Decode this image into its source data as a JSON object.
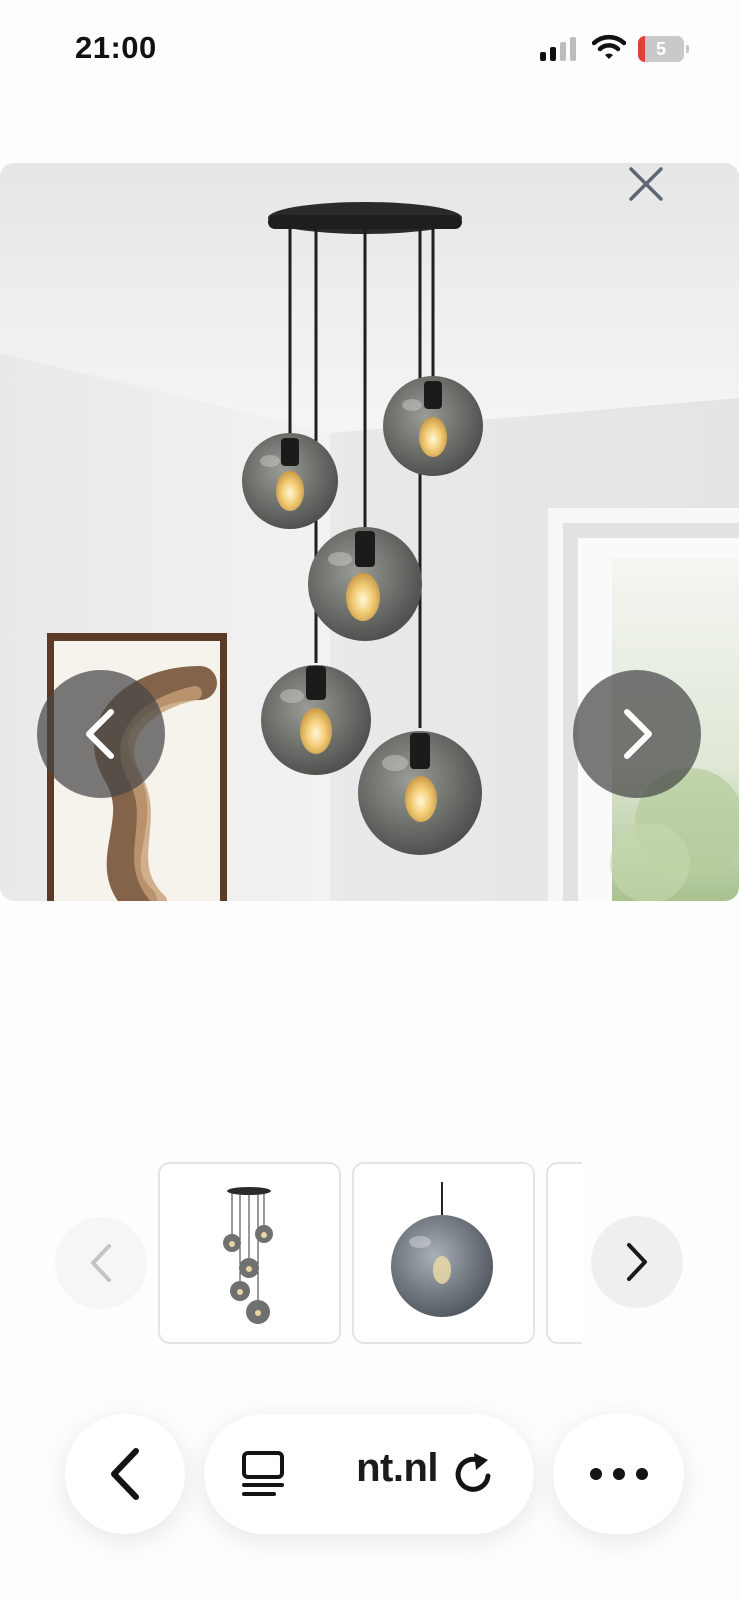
{
  "status_bar": {
    "time": "21:00",
    "battery_level": "5",
    "icons": [
      "cellular-signal-icon",
      "wifi-icon",
      "battery-icon"
    ]
  },
  "gallery": {
    "close_icon": "close-icon",
    "prev_icon": "chevron-left-icon",
    "next_icon": "chevron-right-icon"
  },
  "thumbnails": {
    "prev_icon": "chevron-left-icon",
    "next_icon": "chevron-right-icon",
    "prev_disabled": true,
    "count_visible": 3
  },
  "toolbar": {
    "back_icon": "chevron-left-icon",
    "reader_icon": "reader-mode-icon",
    "url": "nt.nl",
    "reload_icon": "reload-icon",
    "more_icon": "more-dots-icon"
  },
  "colors": {
    "overlay_button": "#464646",
    "text": "#111111",
    "battery_low": "#e0403b"
  }
}
